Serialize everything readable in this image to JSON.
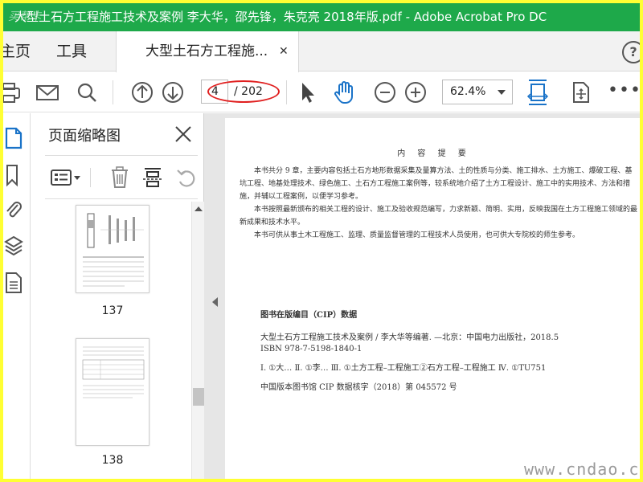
{
  "window": {
    "title": "大型土石方工程施工技术及案例 李大华，邵先锋，朱克亮 2018年版.pdf - Adobe Acrobat Pro DC",
    "title_watermark": "买帮卡"
  },
  "tabs": {
    "home": "主页",
    "tools": "工具",
    "document": "大型土石方工程施...",
    "close_glyph": "✕",
    "help_glyph": "?"
  },
  "toolbar": {
    "current_page": "4",
    "total_pages": "/ 202",
    "zoom": "62.4%",
    "more_glyph": "•••",
    "icons": [
      "print-icon",
      "email-icon",
      "search-icon",
      "page-up-icon",
      "page-down-icon",
      "select-cursor-icon",
      "hand-tool-icon",
      "zoom-out-icon",
      "zoom-in-icon",
      "fit-width-icon",
      "rotate-view-icon",
      "more-icon"
    ],
    "accent_color": "#1a73c8",
    "annotation_color": "#e02020"
  },
  "rail": {
    "icons": [
      "page-thumbnails-icon",
      "bookmarks-icon",
      "attachments-icon",
      "layers-icon",
      "document-properties-icon"
    ]
  },
  "thumbnail_panel": {
    "title": "页面缩略图",
    "tools": [
      "thumbnail-options-icon",
      "delete-page-icon",
      "extract-page-icon",
      "rotate-page-icon"
    ],
    "thumbnails": [
      {
        "page_label": "137"
      },
      {
        "page_label": "138"
      }
    ]
  },
  "document": {
    "heading": "内 容 提 要",
    "paragraphs": [
      "本书共分 9 章，主要内容包括土石方地形数据采集及量算方法、土的性质与分类、施工排水、土方施工、爆破工程、基坑工程、地基处理技术、绿色施工、土石方工程施工案例等，较系统地介绍了土方工程设计、施工中的实用技术、方法和措施，并辅以工程案例，以便学习参考。",
      "本书按照最新颁布的相关工程的设计、施工及验收规范编写，力求新颖、简明、实用，反映我国在土方工程施工领域的最新成果和技术水平。",
      "本书可供从事土木工程施工、监理、质量监督管理的工程技术人员使用，也可供大专院校的师生参考。"
    ],
    "cip": {
      "title": "图书在版编目（CIP）数据",
      "line1": "大型土石方工程施工技术及案例 / 李大华等编著. —北京：中国电力出版社，2018.5",
      "line2": "ISBN 978-7-5198-1840-1",
      "line3": "Ⅰ. ①大…  Ⅱ. ①李…  Ⅲ. ①土方工程–工程施工②石方工程–工程施工  Ⅳ. ①TU751",
      "line4": "中国版本图书馆 CIP 数据核字（2018）第 045572 号"
    }
  },
  "watermark": "www.cndao.com"
}
